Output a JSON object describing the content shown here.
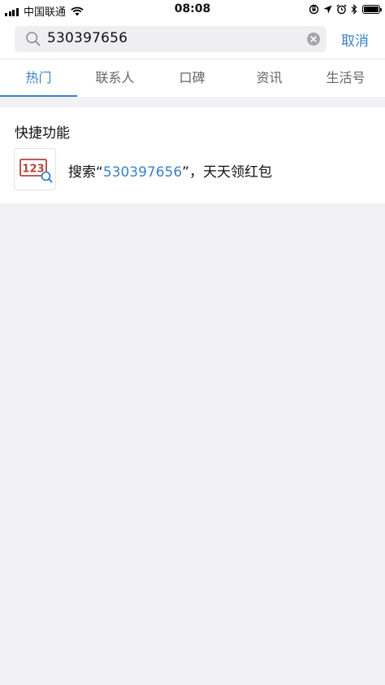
{
  "status_bar": {
    "carrier": "中国联通",
    "time": "08:08"
  },
  "search": {
    "value": "530397656",
    "cancel_label": "取消"
  },
  "tabs": [
    {
      "label": "热门",
      "active": true
    },
    {
      "label": "联系人",
      "active": false
    },
    {
      "label": "口碑",
      "active": false
    },
    {
      "label": "资讯",
      "active": false
    },
    {
      "label": "生活号",
      "active": false
    }
  ],
  "quick": {
    "title": "快捷功能",
    "item": {
      "icon_text": "123",
      "prefix": "搜索“",
      "highlight": "530397656",
      "suffix": "”，天天领红包"
    }
  },
  "colors": {
    "accent": "#3b82c8",
    "icon_red": "#b5443a",
    "background": "#f2f2f6"
  }
}
